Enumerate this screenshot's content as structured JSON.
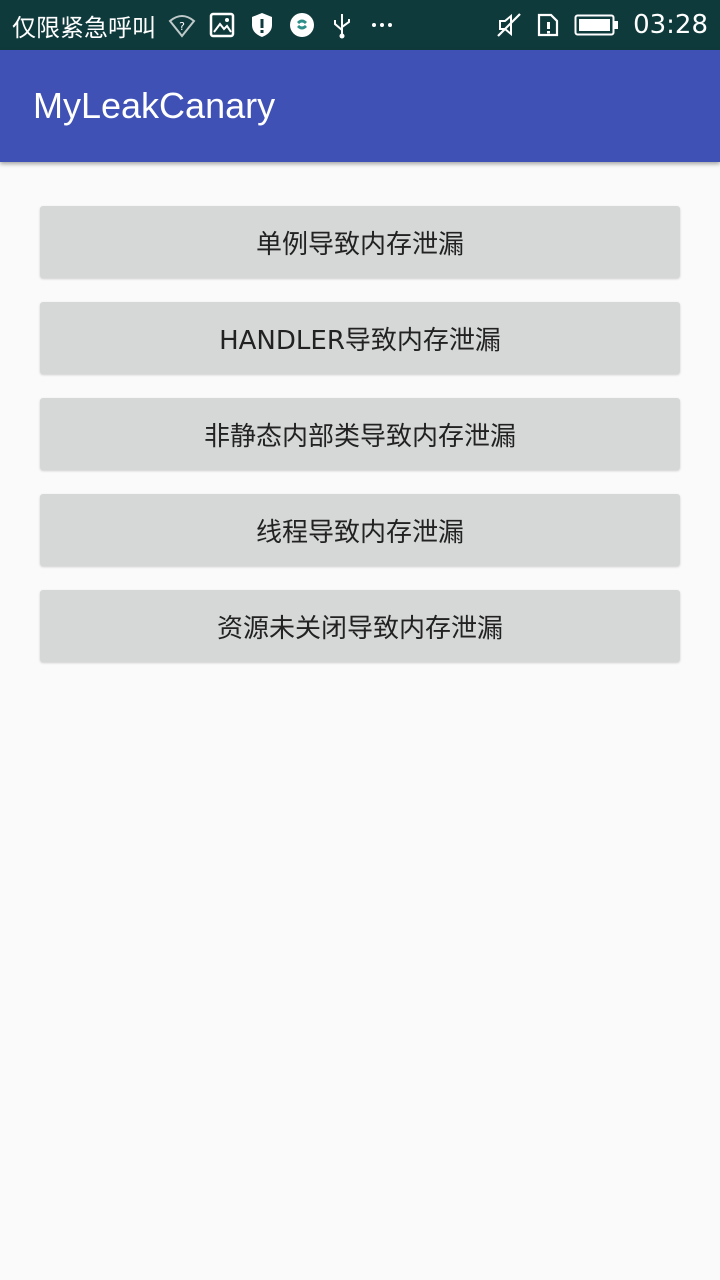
{
  "status_bar": {
    "carrier": "仅限紧急呼叫",
    "time": "03:28",
    "icons_left": [
      "wifi-question-icon",
      "image-icon",
      "shield-icon",
      "security-app-icon",
      "usb-icon",
      "more-icon"
    ],
    "icons_right": [
      "sound-off-icon",
      "sim-alert-icon",
      "battery-icon"
    ],
    "background": "#0F3A3C"
  },
  "app_bar": {
    "title": "MyLeakCanary",
    "color": "#3F51B5"
  },
  "buttons": [
    {
      "label": "单例导致内存泄漏"
    },
    {
      "label": "HANDLER导致内存泄漏"
    },
    {
      "label": "非静态内部类导致内存泄漏"
    },
    {
      "label": "线程导致内存泄漏"
    },
    {
      "label": "资源未关闭导致内存泄漏"
    }
  ]
}
